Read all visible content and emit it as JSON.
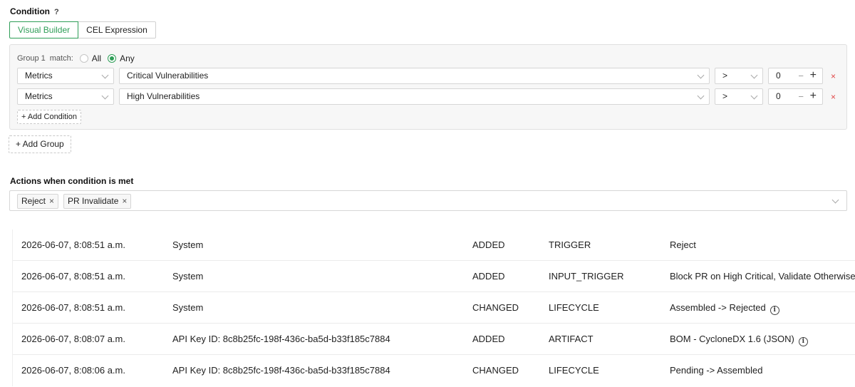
{
  "condition": {
    "title": "Condition",
    "help": "?",
    "modes": [
      "Visual Builder",
      "CEL Expression"
    ],
    "group": {
      "label": "Group 1",
      "match_label": "match:",
      "options": [
        "All",
        "Any"
      ],
      "selected": "Any",
      "rows": [
        {
          "source": "Metrics",
          "field": "Critical Vulnerabilities",
          "operator": ">",
          "value": "0"
        },
        {
          "source": "Metrics",
          "field": "High Vulnerabilities",
          "operator": ">",
          "value": "0"
        }
      ],
      "add_condition": "+ Add Condition"
    },
    "add_group": "+ Add Group"
  },
  "actions": {
    "title": "Actions when condition is met",
    "tags": [
      "Reject",
      "PR Invalidate"
    ]
  },
  "audit_log": [
    {
      "time": "2026-06-07, 8:08:51 a.m.",
      "actor": "System",
      "op": "ADDED",
      "type": "TRIGGER",
      "detail": "Reject",
      "info": false
    },
    {
      "time": "2026-06-07, 8:08:51 a.m.",
      "actor": "System",
      "op": "ADDED",
      "type": "INPUT_TRIGGER",
      "detail": "Block PR on High Critical, Validate Otherwise",
      "info": false
    },
    {
      "time": "2026-06-07, 8:08:51 a.m.",
      "actor": "System",
      "op": "CHANGED",
      "type": "LIFECYCLE",
      "detail": "Assembled -> Rejected",
      "info": true
    },
    {
      "time": "2026-06-07, 8:08:07 a.m.",
      "actor": "API Key ID: 8c8b25fc-198f-436c-ba5d-b33f185c7884",
      "op": "ADDED",
      "type": "ARTIFACT",
      "detail": "BOM - CycloneDX 1.6 (JSON)",
      "info": true
    },
    {
      "time": "2026-06-07, 8:08:06 a.m.",
      "actor": "API Key ID: 8c8b25fc-198f-436c-ba5d-b33f185c7884",
      "op": "CHANGED",
      "type": "LIFECYCLE",
      "detail": "Pending -> Assembled",
      "info": false
    }
  ],
  "icons": {
    "chevron": "chevron-down-icon",
    "remove": "×",
    "plus": "+",
    "minus": "−",
    "info": "i"
  },
  "colors": {
    "accent": "#2e9e57",
    "danger": "#e04848"
  }
}
